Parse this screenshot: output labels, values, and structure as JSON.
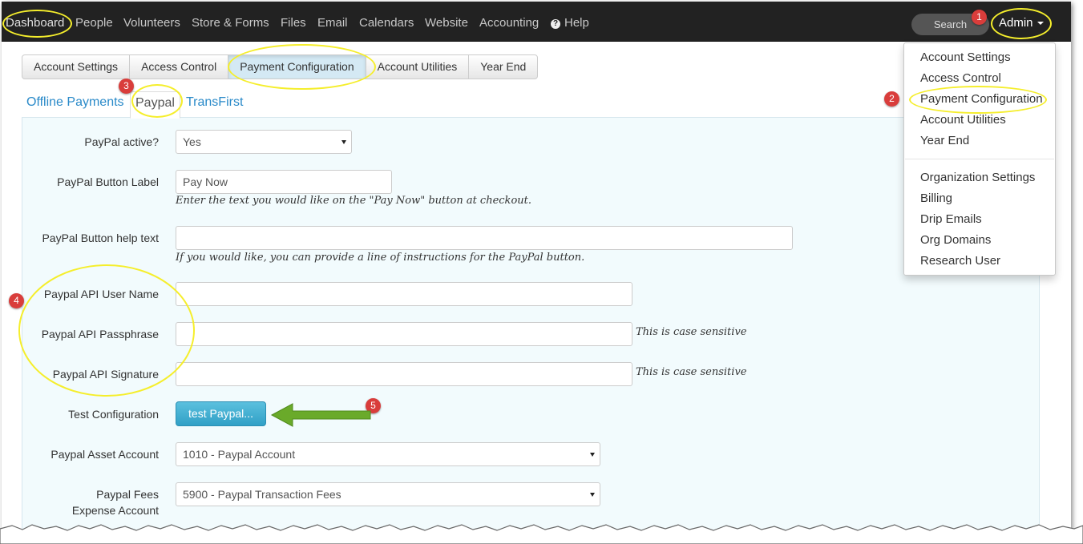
{
  "navbar": {
    "items": [
      "Dashboard",
      "People",
      "Volunteers",
      "Store & Forms",
      "Files",
      "Email",
      "Calendars",
      "Website",
      "Accounting"
    ],
    "help_label": "Help",
    "help_icon": "question-circle-icon",
    "search_label": "Search",
    "admin_label": "Admin"
  },
  "tabs": [
    "Account Settings",
    "Access Control",
    "Payment Configuration",
    "Account Utilities",
    "Year End"
  ],
  "active_tab": "Payment Configuration",
  "subtabs": [
    "Offline Payments",
    "Paypal",
    "TransFirst"
  ],
  "active_subtab": "Paypal",
  "form": {
    "paypal_active_label": "PayPal active?",
    "paypal_active_value": "Yes",
    "button_label_label": "PayPal Button Label",
    "button_label_value": "Pay Now",
    "button_label_hint": "Enter the text you would like on the \"Pay Now\" button at checkout.",
    "help_text_label": "PayPal Button help text",
    "help_text_value": "",
    "help_text_hint": "If you would like, you can provide a line of instructions for the PayPal button.",
    "api_user_label": "Paypal API User Name",
    "api_pass_label": "Paypal API Passphrase",
    "api_pass_hint": "This is case sensitive",
    "api_sig_label": "Paypal API Signature",
    "api_sig_hint": "This is case sensitive",
    "test_label": "Test Configuration",
    "test_button": "test Paypal...",
    "asset_label": "Paypal Asset Account",
    "asset_value": "1010 - Paypal Account",
    "fees_label_1": "Paypal Fees",
    "fees_label_2": "Expense Account",
    "fees_value": "5900 - Paypal Transaction Fees"
  },
  "admin_menu": {
    "group1": [
      "Account Settings",
      "Access Control",
      "Payment Configuration",
      "Account Utilities",
      "Year End"
    ],
    "group2": [
      "Organization Settings",
      "Billing",
      "Drip Emails",
      "Org Domains",
      "Research User"
    ]
  },
  "annotations": {
    "badges": [
      "1",
      "2",
      "3",
      "4",
      "5"
    ],
    "highlight_color": "#f5ee2c",
    "badge_color": "#d93d3b",
    "arrow_color": "#6aaa2a"
  },
  "colors": {
    "navbar": "#222222",
    "link": "#2a8ac9",
    "panel_bg": "#f2fbfd",
    "info_button": "#5bc0de"
  }
}
